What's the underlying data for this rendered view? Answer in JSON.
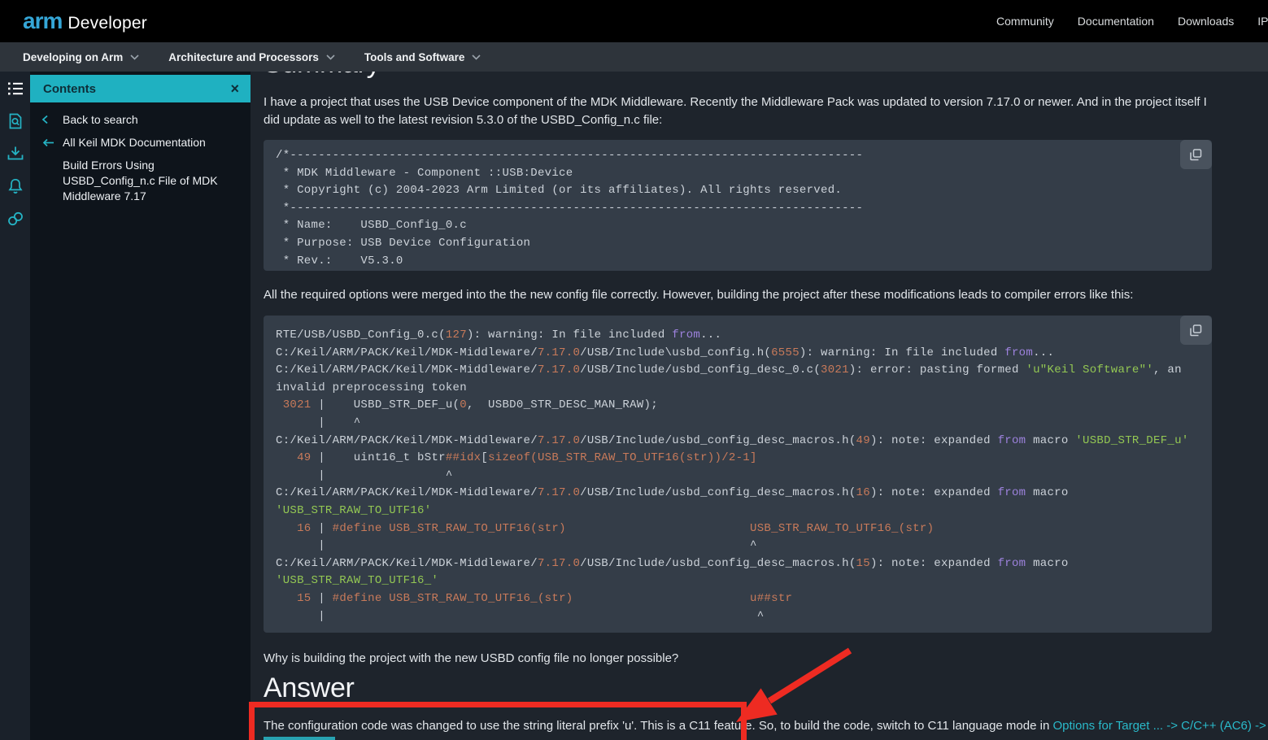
{
  "colors": {
    "accent_teal": "#25b4c5",
    "contents_header_teal": "#1fb1c1",
    "link_teal": "#2ab9c9",
    "annotation_red": "#ee2b22",
    "code_orange": "#c87a5a",
    "code_green": "#93c753",
    "code_purple": "#9d82dd"
  },
  "header": {
    "logo_brand": "arm",
    "logo_product": "Developer",
    "nav": [
      "Community",
      "Documentation",
      "Downloads",
      "IP Explorer"
    ]
  },
  "navbar": {
    "items": [
      "Developing on Arm",
      "Architecture and Processors",
      "Tools and Software"
    ]
  },
  "rail": {
    "icons": [
      "table-of-contents",
      "document-search",
      "downloads",
      "notifications",
      "links"
    ]
  },
  "contents": {
    "title": "Contents",
    "close_label": "×",
    "back_to_search": "Back to search",
    "parent_doc": "All Keil MDK Documentation",
    "current_doc": "Build Errors Using USBD_Config_n.c File of MDK Middleware 7.17"
  },
  "main": {
    "summary_heading": "Summary",
    "intro": "I have a project that uses the USB Device component of the MDK Middleware. Recently the Middleware Pack was updated to version 7.17.0 or newer. And in the project itself I did update as well to the latest revision 5.3.0 of the USBD_Config_n.c file:",
    "code1": {
      "lines": [
        "/*---------------------------------------------------------------------------------",
        " * MDK Middleware - Component ::USB:Device",
        " * Copyright (c) 2004-2023 Arm Limited (or its affiliates). All rights reserved.",
        " *---------------------------------------------------------------------------------",
        " * Name:    USBD_Config_0.c",
        " * Purpose: USB Device Configuration",
        " * Rev.:    V5.3.0"
      ]
    },
    "between": "All the required options were merged into the the new config file correctly. However, building the project after these modifications leads to compiler errors like this:",
    "code2": {
      "lines": [
        [
          [
            "RTE/USB/USBD_Config_0.c(",
            "d"
          ],
          [
            "127",
            "o"
          ],
          [
            "): warning: In file included ",
            "d"
          ],
          [
            "from",
            "p"
          ],
          [
            "...",
            "d"
          ]
        ],
        [
          [
            "C:/Keil/ARM/PACK/Keil/MDK-Middleware/",
            "d"
          ],
          [
            "7.17.0",
            "o"
          ],
          [
            "/USB/Include\\usbd_config.h(",
            "d"
          ],
          [
            "6555",
            "o"
          ],
          [
            "): warning: In file included ",
            "d"
          ],
          [
            "from",
            "p"
          ],
          [
            "...",
            "d"
          ]
        ],
        [
          [
            "C:/Keil/ARM/PACK/Keil/MDK-Middleware/",
            "d"
          ],
          [
            "7.17.0",
            "o"
          ],
          [
            "/USB/Include/usbd_config_desc_0.c(",
            "d"
          ],
          [
            "3021",
            "o"
          ],
          [
            "): error: pasting formed ",
            "d"
          ],
          [
            "'u\"Keil Software\"'",
            "g"
          ],
          [
            ", an",
            "d"
          ]
        ],
        [
          [
            "invalid preprocessing token",
            "d"
          ]
        ],
        [
          [
            " 3021",
            "o"
          ],
          [
            " |    USBD_STR_DEF_u(",
            "d"
          ],
          [
            "0",
            "o"
          ],
          [
            ",  USBD0_STR_DESC_MAN_RAW);",
            "d"
          ]
        ],
        [
          [
            "      |    ^",
            "d"
          ]
        ],
        [
          [
            "C:/Keil/ARM/PACK/Keil/MDK-Middleware/",
            "d"
          ],
          [
            "7.17.0",
            "o"
          ],
          [
            "/USB/Include/usbd_config_desc_macros.h(",
            "d"
          ],
          [
            "49",
            "o"
          ],
          [
            "): note: expanded ",
            "d"
          ],
          [
            "from",
            "p"
          ],
          [
            " macro ",
            "d"
          ],
          [
            "'USBD_STR_DEF_u'",
            "g"
          ]
        ],
        [
          [
            "   49",
            "o"
          ],
          [
            " |    uint16_t bStr",
            "d"
          ],
          [
            "##idx",
            "o"
          ],
          [
            "[",
            "d"
          ],
          [
            "sizeof(USB_STR_RAW_TO_UTF16(str))/2-1]",
            "o"
          ]
        ],
        [
          [
            "      |                 ^",
            "d"
          ]
        ],
        [
          [
            "C:/Keil/ARM/PACK/Keil/MDK-Middleware/",
            "d"
          ],
          [
            "7.17.0",
            "o"
          ],
          [
            "/USB/Include/usbd_config_desc_macros.h(",
            "d"
          ],
          [
            "16",
            "o"
          ],
          [
            "): note: expanded ",
            "d"
          ],
          [
            "from",
            "p"
          ],
          [
            " macro",
            "d"
          ]
        ],
        [
          [
            "'USB_STR_RAW_TO_UTF16'",
            "g"
          ]
        ],
        [
          [
            "   16",
            "o"
          ],
          [
            " | ",
            "d"
          ],
          [
            "#define USB_STR_RAW_TO_UTF16(str)",
            "o"
          ],
          [
            "                          ",
            "d"
          ],
          [
            "USB_STR_RAW_TO_UTF16_(str)",
            "o"
          ]
        ],
        [
          [
            "      |                                                            ^",
            "d"
          ]
        ],
        [
          [
            "C:/Keil/ARM/PACK/Keil/MDK-Middleware/",
            "d"
          ],
          [
            "7.17.0",
            "o"
          ],
          [
            "/USB/Include/usbd_config_desc_macros.h(",
            "d"
          ],
          [
            "15",
            "o"
          ],
          [
            "): note: expanded ",
            "d"
          ],
          [
            "from",
            "p"
          ],
          [
            " macro",
            "d"
          ]
        ],
        [
          [
            "'USB_STR_RAW_TO_UTF16_'",
            "g"
          ]
        ],
        [
          [
            "   15",
            "o"
          ],
          [
            " | ",
            "d"
          ],
          [
            "#define USB_STR_RAW_TO_UTF16_(str)",
            "o"
          ],
          [
            "                         ",
            "d"
          ],
          [
            "u##str",
            "o"
          ]
        ],
        [
          [
            "      |                                                             ^",
            "d"
          ]
        ]
      ]
    },
    "question": "Why is building the project with the new USBD config file no longer possible?",
    "answer_heading": "Answer",
    "answer_text": "The configuration code was changed to use the string literal prefix 'u'. This is a C11 feature. So, to build the code, switch to C11 language mode in ",
    "answer_link": "Options for Target ... -> C/C++ (AC6) ->"
  }
}
